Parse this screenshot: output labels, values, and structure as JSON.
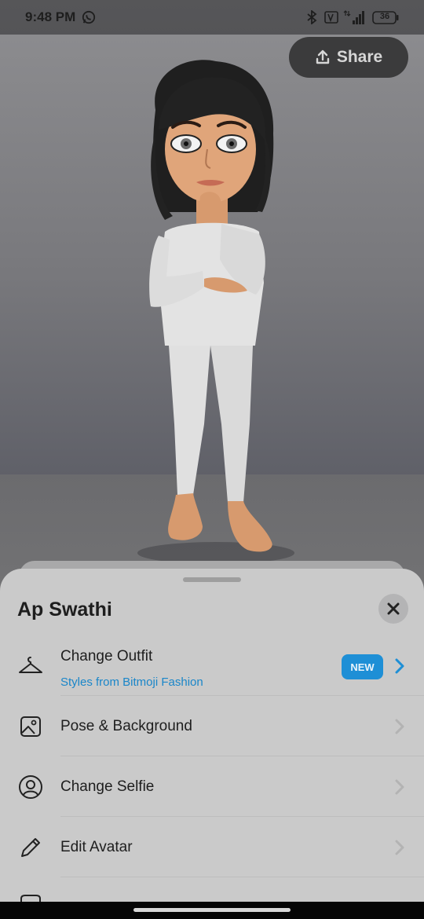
{
  "status_bar": {
    "time": "9:48 PM",
    "battery": "36",
    "icons": [
      "whatsapp-icon",
      "bluetooth-icon",
      "volte-icon",
      "signal-icon",
      "battery-icon"
    ]
  },
  "share": {
    "label": "Share",
    "icon": "share-upload-icon"
  },
  "sheet": {
    "title": "Ap Swathi",
    "close_icon": "close-icon",
    "items": [
      {
        "label": "Change Outfit",
        "sublabel": "Styles from Bitmoji Fashion",
        "badge": "NEW",
        "icon": "hanger-icon",
        "highlight": true
      },
      {
        "label": "Pose & Background",
        "icon": "image-frame-icon",
        "highlight": false
      },
      {
        "label": "Change Selfie",
        "icon": "selfie-face-icon",
        "highlight": false
      },
      {
        "label": "Edit Avatar",
        "icon": "pencil-icon",
        "highlight": false
      }
    ]
  },
  "colors": {
    "accent": "#1e8fd6",
    "sheet_bg": "#cacaca",
    "share_bg": "#3b3b3c"
  }
}
